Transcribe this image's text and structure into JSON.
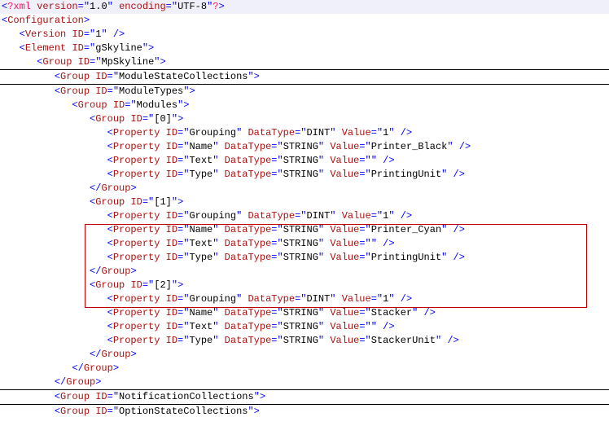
{
  "xml_decl": {
    "tag": "?xml",
    "ver_attr": "version",
    "ver_val": "1.0",
    "enc_attr": "encoding",
    "enc_val": "UTF-8",
    "end": "?"
  },
  "cfg_open": "Configuration",
  "version_tag": {
    "tag": "Version",
    "id_attr": "ID",
    "id_val": "1"
  },
  "element_tag": {
    "tag": "Element",
    "id_attr": "ID",
    "id_val": "gSkyline"
  },
  "group": "Group",
  "grp_mpskyline": "MpSkyline",
  "grp_msc": "ModuleStateCollections",
  "grp_mt": "ModuleTypes",
  "grp_modules": "Modules",
  "grp_0": "[0]",
  "grp_1": "[1]",
  "grp_2": "[2]",
  "prop": "Property",
  "id_a": "ID",
  "dt_a": "DataType",
  "val_a": "Value",
  "p_grouping": "Grouping",
  "p_name": "Name",
  "p_text": "Text",
  "p_type": "Type",
  "dt_dint": "DINT",
  "dt_string": "STRING",
  "v_1": "1",
  "v_pb": "Printer_Black",
  "v_pc": "Printer_Cyan",
  "v_st": "Stacker",
  "v_pu": "PrintingUnit",
  "v_su": "StackerUnit",
  "v_empty": "",
  "close_group": "Group",
  "grp_nc": "NotificationCollections",
  "grp_osc": "OptionStateCollections"
}
